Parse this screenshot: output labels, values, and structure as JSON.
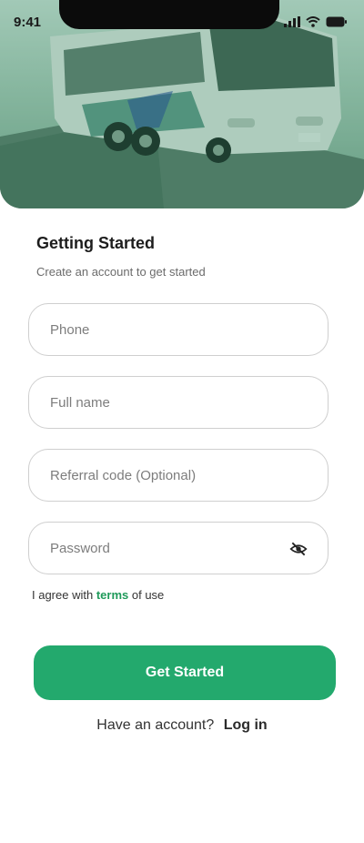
{
  "status_bar": {
    "time": "9:41"
  },
  "header": {
    "title": "Getting Started",
    "subtitle": "Create an account to get started"
  },
  "form": {
    "phone_placeholder": "Phone",
    "fullname_placeholder": "Full name",
    "referral_placeholder": "Referral code (Optional)",
    "password_placeholder": "Password",
    "password_toggle_icon": "eye-off-icon"
  },
  "agreement": {
    "prefix": "I agree with",
    "terms_link": "terms",
    "suffix": "of use"
  },
  "actions": {
    "primary_label": "Get Started"
  },
  "login": {
    "prompt": "Have an account?",
    "link": "Log in"
  },
  "colors": {
    "brand": "#23a96d",
    "terms_link": "#1f9a5a"
  }
}
